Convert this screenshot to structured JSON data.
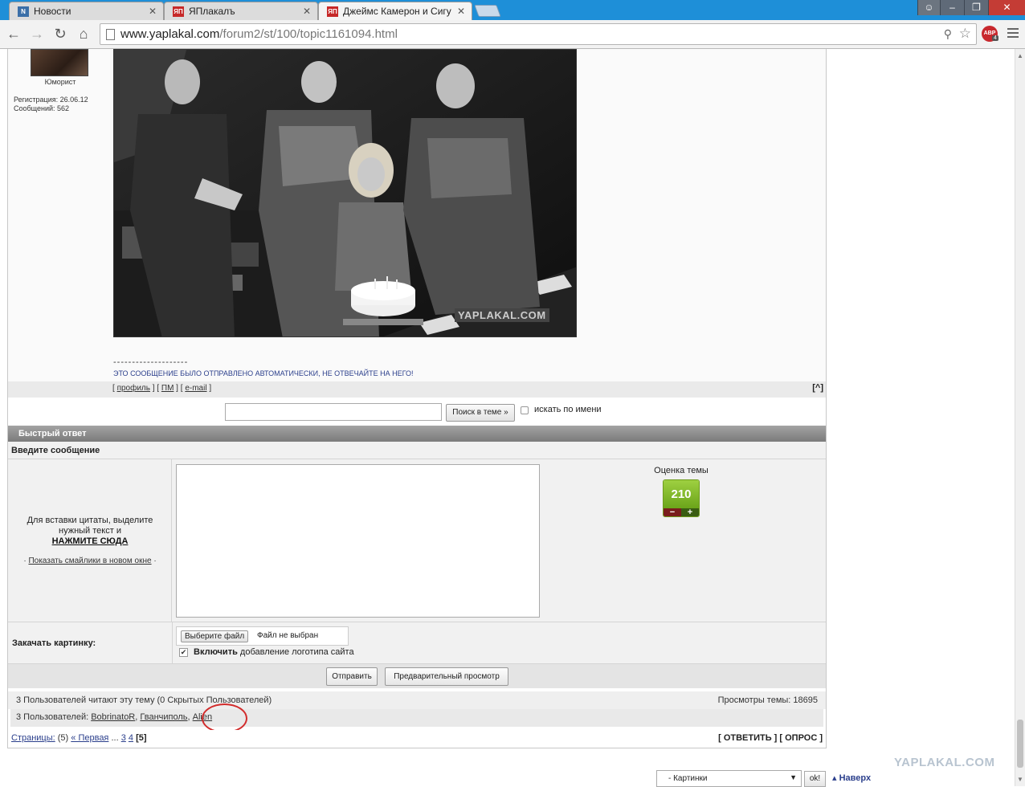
{
  "browser": {
    "tabs": [
      {
        "label": "Новости"
      },
      {
        "label": "ЯПлакалъ"
      },
      {
        "label": "Джеймс Камерон и Сигу"
      }
    ],
    "favicon_yap": "ЯП",
    "close_glyph": "✕",
    "url_host": "www.yaplakal.com",
    "url_path": "/forum2/st/100/topic1161094.html",
    "abp_label": "ABP",
    "abp_count": "4"
  },
  "post": {
    "author_rank": "Юморист",
    "registration": "Регистрация: 26.06.12",
    "messages": "Сообщений: 562",
    "watermark": "YAPLAKAL.COM",
    "sig_line": "--------------------",
    "auto_message": "ЭТО СООБЩЕНИЕ БЫЛО ОТПРАВЛЕНО АВТОМАТИЧЕСКИ, НЕ ОТВЕЧАЙТЕ НА НЕГО!",
    "links": {
      "profile": "профиль",
      "pm": "ПМ",
      "email": "e-mail"
    },
    "to_top": "[^]"
  },
  "search": {
    "button": "Поиск в теме »",
    "by_name": "искать по имени"
  },
  "quick_reply": {
    "header": "Быстрый ответ",
    "sub": "Введите сообщение",
    "hint_line1": "Для вставки цитаты, выделите",
    "hint_line2": "нужный текст и",
    "hint_strong": "НАЖМИТЕ СЮДА",
    "smiles_link": "Показать смайлики в новом окне",
    "rating_label": "Оценка темы",
    "rating_value": "210",
    "upload_label": "Закачать картинку:",
    "file_button": "Выберите файл",
    "file_status": "Файл не выбран",
    "logo_bold": "Включить",
    "logo_rest": "добавление логотипа сайта",
    "send": "Отправить",
    "preview": "Предварительный просмотр"
  },
  "stats": {
    "reading": "3 Пользователей читают эту тему (0 Скрытых Пользователей)",
    "views": "Просмотры темы: 18695",
    "users_prefix": "3 Пользователей:",
    "users": [
      "BobrinatoR",
      "Гванчиполь",
      "Alien"
    ]
  },
  "pagination": {
    "label": "Страницы:",
    "count": "(5)",
    "first": "« Первая",
    "dots": "...",
    "p3": "3",
    "p4": "4",
    "current": "[5]",
    "actions": "[ ОТВЕТИТЬ ] [ ОПРОС ]"
  },
  "footer": {
    "brand": "YAPLAKAL.COM",
    "category": "- Картинки",
    "ok": "ok!",
    "up": "Наверх"
  },
  "colors": {
    "tabbar": "#1e8fd8",
    "link_blue": "#2b3f8c",
    "rating_green": "#8cc63f",
    "highlight_red": "#d22c2c"
  }
}
